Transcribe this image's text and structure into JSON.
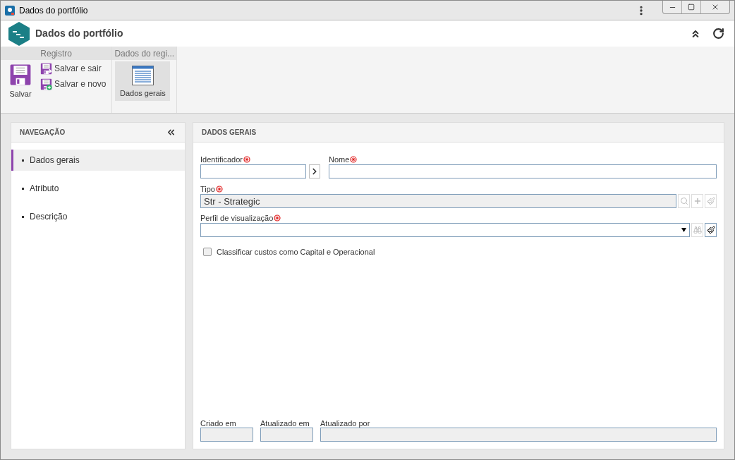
{
  "window": {
    "title": "Dados do portfólio"
  },
  "header": {
    "title": "Dados do portfólio"
  },
  "ribbon": {
    "groups": [
      {
        "title": "Registro",
        "buttons": [
          {
            "kind": "large",
            "label": "Salvar"
          },
          {
            "kind": "small",
            "label": "Salvar e sair"
          },
          {
            "kind": "small",
            "label": "Salvar e novo"
          }
        ]
      },
      {
        "title": "Dados do regi...",
        "buttons": [
          {
            "kind": "tile",
            "label": "Dados gerais",
            "selected": true
          }
        ]
      }
    ]
  },
  "navigation": {
    "title": "NAVEGAÇÃO",
    "items": [
      {
        "label": "Dados gerais",
        "selected": true
      },
      {
        "label": "Atributo",
        "selected": false
      },
      {
        "label": "Descrição",
        "selected": false
      }
    ]
  },
  "form": {
    "title": "DADOS GERAIS",
    "identificador": {
      "label": "Identificador"
    },
    "nome": {
      "label": "Nome"
    },
    "tipo": {
      "label": "Tipo",
      "value": "Str - Strategic"
    },
    "perfil": {
      "label": "Perfil de visualização"
    },
    "checkbox": {
      "label": "Classificar custos como Capital e Operacional",
      "checked": false
    },
    "footer": [
      {
        "label": "Criado em"
      },
      {
        "label": "Atualizado em"
      },
      {
        "label": "Atualizado por"
      }
    ]
  }
}
